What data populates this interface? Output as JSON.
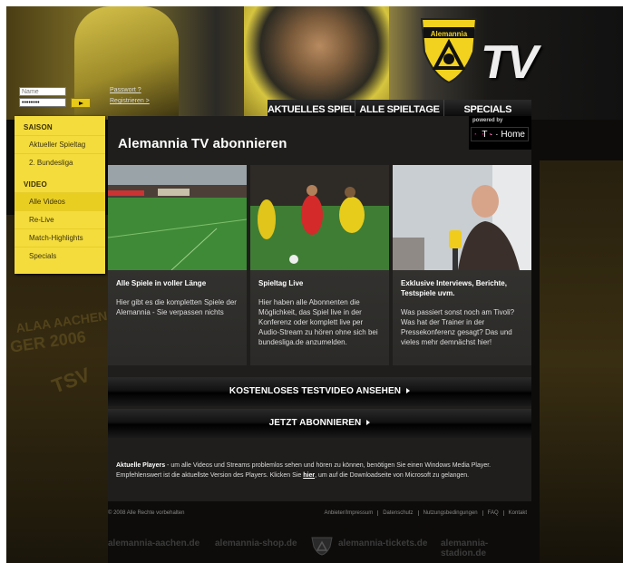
{
  "login": {
    "name_placeholder": "Name",
    "password_value": "••••••••",
    "password_link": "Passwort ?",
    "register_link": "Registrieren >"
  },
  "logo": {
    "tv_text": "TV",
    "shield_text": "Alemannia"
  },
  "nav": {
    "tabs": [
      "AKTUELLES SPIEL",
      "ALLE SPIELTAGE",
      "SPECIALS"
    ]
  },
  "sidebar": {
    "sections": [
      {
        "heading": "SAISON",
        "items": [
          "Aktueller Spieltag",
          "2. Bundesliga"
        ]
      },
      {
        "heading": "VIDEO",
        "items": [
          "Alle Videos",
          "Re-Live",
          "Match-Highlights",
          "Specials"
        ]
      }
    ]
  },
  "main": {
    "title": "Alemannia TV abonnieren",
    "powered_label": "powered by",
    "powered_brand": "T · · Home",
    "powered_dots": "· · ·",
    "features": [
      {
        "title": "Alle Spiele in voller Länge",
        "text": "Hier gibt es die kompletten Spiele der Alemannia - Sie verpassen nichts"
      },
      {
        "title": "Spieltag Live",
        "text": "Hier haben alle Abonnenten die Möglichkeit, das Spiel live in der Konferenz oder komplett live per Audio-Stream zu hören ohne sich bei bundesliga.de anzumelden."
      },
      {
        "title": "Exklusive Interviews, Berichte, Testspiele uvm.",
        "text": "Was passiert sonst noch am Tivoli? Was hat der Trainer in der Pressekonferenz gesagt? Das und vieles mehr demnächst hier!"
      }
    ],
    "cta_test": "KOSTENLOSES TESTVIDEO ANSEHEN",
    "cta_subscribe": "JETZT ABONNIEREN",
    "info_bold": "Aktuelle Players",
    "info_text": " - um alle Videos und Streams problemlos sehen und hören zu können, benötigen Sie einen Windows Media Player. Empfehlenswert ist die aktuellste Version des Players. Klicken Sie ",
    "info_link": "hier",
    "info_tail": ", um auf die Downloadseite von Microsoft zu gelangen."
  },
  "footer": {
    "copyright": "© 2008 Alle Rechte vorbehalten",
    "links": [
      "Anbieter/Impressum",
      "Datenschutz",
      "Nutzungsbedingungen",
      "FAQ",
      "Kontakt"
    ]
  },
  "partners": [
    "alemannia-aachen.de",
    "alemannia-shop.de",
    "alemannia-tickets.de",
    "alemannia-stadion.de"
  ],
  "background": {
    "left_text": "ALAA AACHEN",
    "left_year": "GER 2006",
    "left_tsv": "TSV"
  },
  "colors": {
    "sidebar_yellow": "#f3dc3c",
    "accent_yellow": "#e8c818",
    "telekom_magenta": "#e2007a"
  }
}
